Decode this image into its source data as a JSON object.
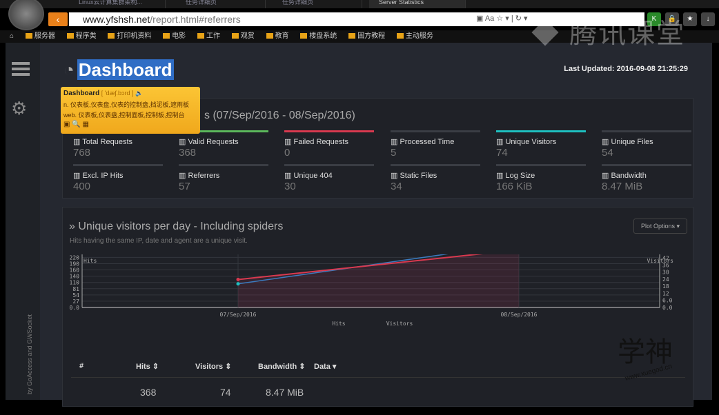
{
  "browser": {
    "tabs": [
      "Linux云计算集群架构...",
      "任务详细页",
      "任务详细页",
      "Server Statistics"
    ],
    "url_host": "www.yfshsh.net",
    "url_path": "/report.html#referrers",
    "bookmarks": [
      "服务器",
      "程序类",
      "打印机资料",
      "电影",
      "工作",
      "观赏",
      "教育",
      "楼盘系统",
      "固方教程",
      "主动服务"
    ]
  },
  "watermarks": {
    "tencent": "腾讯课堂",
    "xueshen": "学神",
    "xueshen_url": "www.xuegod.cn"
  },
  "sidebar": {
    "credit": "by GoAccess and GWSocket"
  },
  "header": {
    "title": "Dashboard",
    "last_updated": "Last Updated: 2016-09-08 21:25:29"
  },
  "dict_popup": {
    "word": "Dashboard",
    "phonetic": "[ 'dæʃ.bɔrd ]",
    "n": "n. 仪表板,仪表盘,仪表的控制盘,挡泥板,遮雨板",
    "web": "web. 仪表板,仪表盘,控制面板,控制板,控制台"
  },
  "overall": {
    "title": "s (07/Sep/2016 - 08/Sep/2016)",
    "stats": [
      {
        "label": "Total Requests",
        "value": "768",
        "color": "#3a3d44"
      },
      {
        "label": "Valid Requests",
        "value": "368",
        "color": "#5cb85c"
      },
      {
        "label": "Failed Requests",
        "value": "0",
        "color": "#d9394f"
      },
      {
        "label": "Processed Time",
        "value": "5",
        "color": "#3a3d44"
      },
      {
        "label": "Unique Visitors",
        "value": "74",
        "color": "#1ec0c0"
      },
      {
        "label": "Unique Files",
        "value": "54",
        "color": "#3a3d44"
      },
      {
        "label": "Excl. IP Hits",
        "value": "400",
        "color": "#3a3d44"
      },
      {
        "label": "Referrers",
        "value": "57",
        "color": "#3a3d44"
      },
      {
        "label": "Unique 404",
        "value": "30",
        "color": "#3a3d44"
      },
      {
        "label": "Static Files",
        "value": "34",
        "color": "#3a3d44"
      },
      {
        "label": "Log Size",
        "value": "166 KiB",
        "color": "#3a3d44"
      },
      {
        "label": "Bandwidth",
        "value": "8.47 MiB",
        "color": "#3a3d44"
      }
    ]
  },
  "visitors": {
    "title": "» Unique visitors per day - Including spiders",
    "subtitle": "Hits having the same IP, date and agent are a unique visit.",
    "plot_options": "Plot Options ▾",
    "table": {
      "headers": [
        "#",
        "Hits ⇕",
        "Visitors ⇕",
        "Bandwidth ⇕",
        "Data ▾"
      ],
      "row": [
        "368",
        "74",
        "8.47 MiB"
      ]
    }
  },
  "chart_data": {
    "type": "line",
    "categories": [
      "07/Sep/2016",
      "08/Sep/2016"
    ],
    "series": [
      {
        "name": "Hits",
        "values": [
          124,
          244
        ],
        "color": "#d9394f",
        "axis": "left"
      },
      {
        "name": "Visitors",
        "values": [
          20,
          54
        ],
        "color": "#3b7bbf",
        "axis": "right"
      }
    ],
    "ylabel_left": "Hits",
    "ylabel_right": "Visitors",
    "left_ticks": [
      "0.0",
      "27",
      "54",
      "81",
      "110",
      "140",
      "160",
      "190",
      "220",
      "240"
    ],
    "right_ticks": [
      "0.0",
      "6.0",
      "12",
      "18",
      "24",
      "30",
      "36",
      "42",
      "48"
    ],
    "legend": [
      "Hits",
      "Visitors"
    ],
    "legend_position": "bottom",
    "grid": true
  }
}
